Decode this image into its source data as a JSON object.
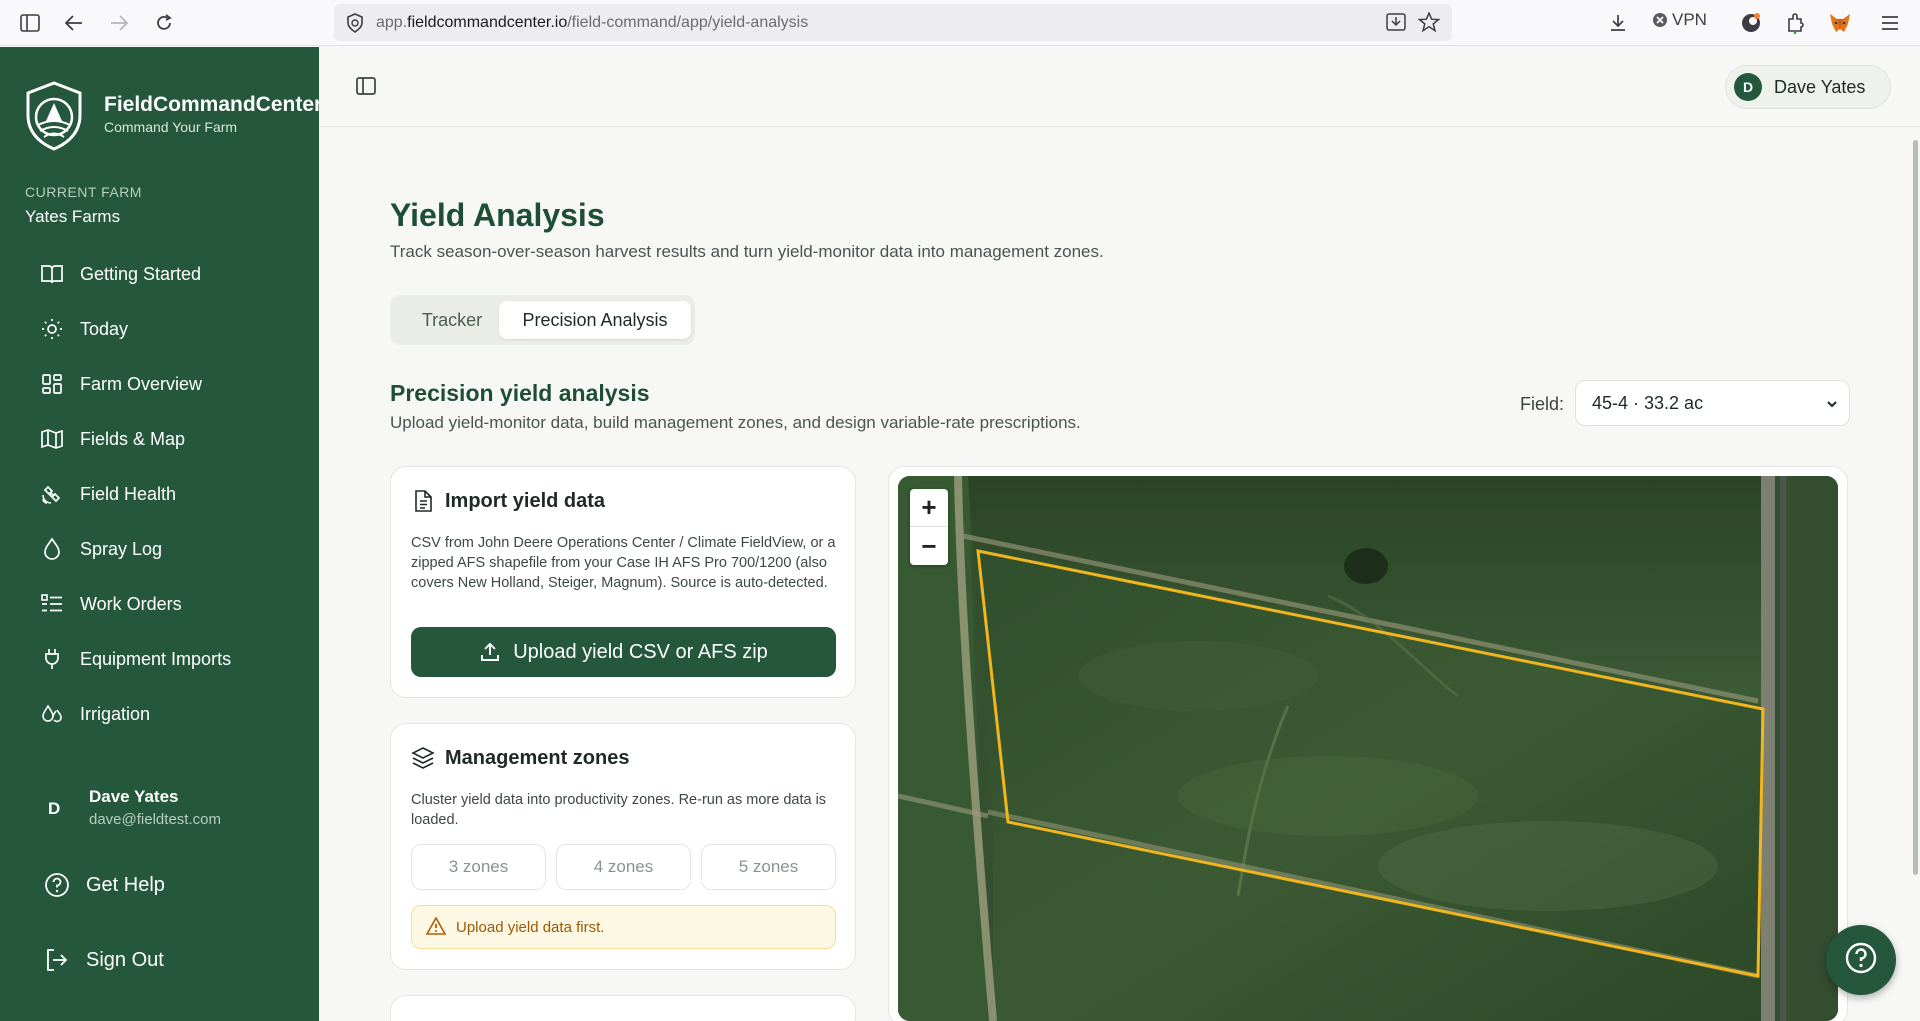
{
  "browser": {
    "url_prefix": "app.",
    "url_domain": "fieldcommandcenter.io",
    "url_path": "/field-command/app/yield-analysis",
    "vpn_label": "VPN"
  },
  "brand": {
    "name": "FieldCommandCenter",
    "tagline": "Command Your Farm"
  },
  "farm": {
    "label": "CURRENT FARM",
    "name": "Yates Farms"
  },
  "nav": {
    "items": [
      {
        "label": "Getting Started",
        "icon": "book-open-icon"
      },
      {
        "label": "Today",
        "icon": "sun-icon"
      },
      {
        "label": "Farm Overview",
        "icon": "grid-icon"
      },
      {
        "label": "Fields & Map",
        "icon": "map-icon"
      },
      {
        "label": "Field Health",
        "icon": "satellite-icon"
      },
      {
        "label": "Spray Log",
        "icon": "droplet-icon"
      },
      {
        "label": "Work Orders",
        "icon": "list-checks-icon"
      },
      {
        "label": "Equipment Imports",
        "icon": "plug-icon"
      },
      {
        "label": "Irrigation",
        "icon": "droplets-icon"
      }
    ]
  },
  "user": {
    "initial": "D",
    "name": "Dave Yates",
    "email": "dave@fieldtest.com"
  },
  "bottom_nav": {
    "help": "Get Help",
    "signout": "Sign Out"
  },
  "header": {
    "user_initial": "D",
    "user_name": "Dave Yates"
  },
  "page": {
    "title": "Yield Analysis",
    "subtitle": "Track season-over-season harvest results and turn yield-monitor data into management zones.",
    "tabs": [
      "Tracker",
      "Precision Analysis"
    ],
    "active_tab": "Precision Analysis"
  },
  "section": {
    "title": "Precision yield analysis",
    "subtitle": "Upload yield-monitor data, build management zones, and design variable-rate prescriptions.",
    "field_label": "Field:",
    "field_value": "45-4 · 33.2 ac"
  },
  "import_card": {
    "title": "Import yield data",
    "description": "CSV from John Deere Operations Center / Climate FieldView, or a zipped AFS shapefile from your Case IH AFS Pro 700/1200 (also covers New Holland, Steiger, Magnum). Source is auto-detected.",
    "button": "Upload yield CSV or AFS zip"
  },
  "zones_card": {
    "title": "Management zones",
    "description": "Cluster yield data into productivity zones. Re-run as more data is loaded.",
    "options": [
      "3 zones",
      "4 zones",
      "5 zones"
    ],
    "warning": "Upload yield data first."
  },
  "map": {
    "zoom_in": "+",
    "zoom_out": "−",
    "boundary_color": "#f2b51d"
  },
  "colors": {
    "sidebar": "#24573c",
    "accent": "#24573c",
    "title": "#1e4e35"
  }
}
